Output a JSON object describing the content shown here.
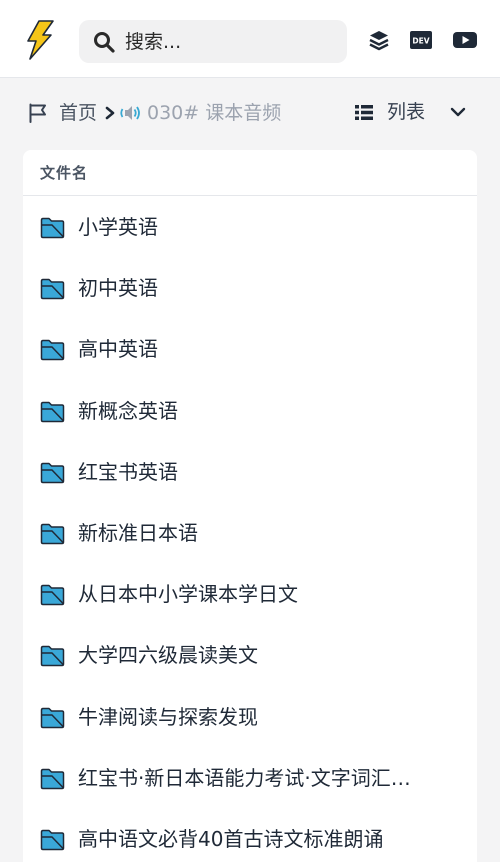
{
  "header": {
    "search_placeholder": "搜索...",
    "logo_icon": "lightning-bolt-icon",
    "icons": [
      "layers-icon",
      "dev-icon",
      "youtube-icon"
    ],
    "dev_badge": "DEV"
  },
  "breadcrumb": {
    "home": "首页",
    "current": "030# 课本音频"
  },
  "view": {
    "label": "列表"
  },
  "table": {
    "column_header": "文件名",
    "items": [
      {
        "name": "小学英语"
      },
      {
        "name": "初中英语"
      },
      {
        "name": "高中英语"
      },
      {
        "name": "新概念英语"
      },
      {
        "name": "红宝书英语"
      },
      {
        "name": "新标准日本语"
      },
      {
        "name": "从日本中小学课本学日文"
      },
      {
        "name": "大学四六级晨读美文"
      },
      {
        "name": "牛津阅读与探索发现"
      },
      {
        "name": "红宝书·新日本语能力考试·文字词汇…"
      },
      {
        "name": "高中语文必背40首古诗文标准朗诵"
      }
    ]
  },
  "colors": {
    "accent_folder": "#38a9d3",
    "logo_yellow": "#f5c518",
    "text": "#1f2937"
  }
}
